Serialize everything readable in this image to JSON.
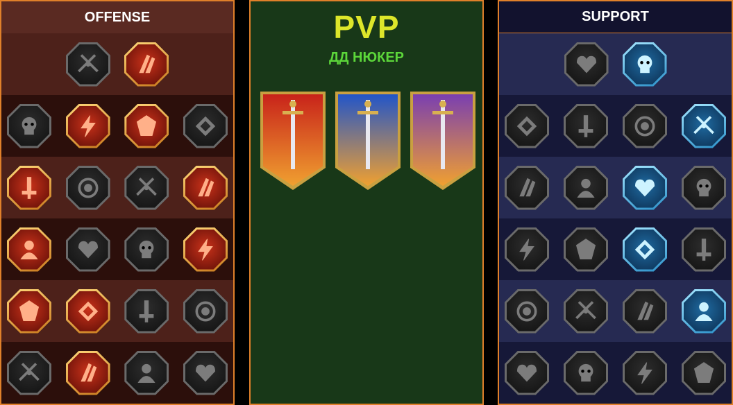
{
  "offense": {
    "title": "OFFENSE",
    "rows": [
      [
        {
          "icon": "crossed-swords-icon",
          "state": "gray"
        },
        {
          "icon": "triple-claw-icon",
          "state": "red"
        }
      ],
      [
        {
          "icon": "horned-demon-icon",
          "state": "gray"
        },
        {
          "icon": "slash-strikes-icon",
          "state": "red"
        },
        {
          "icon": "shield-break-icon",
          "state": "red"
        },
        {
          "icon": "broken-heart-icon",
          "state": "gray"
        }
      ],
      [
        {
          "icon": "arrow-hit-icon",
          "state": "red"
        },
        {
          "icon": "fangs-icon",
          "state": "gray"
        },
        {
          "icon": "skull-swipe-icon",
          "state": "gray"
        },
        {
          "icon": "sickle-hand-icon",
          "state": "red"
        }
      ],
      [
        {
          "icon": "dagger-drop-icon",
          "state": "red"
        },
        {
          "icon": "fist-hammer-icon",
          "state": "gray"
        },
        {
          "icon": "battle-axe-icon",
          "state": "gray"
        },
        {
          "icon": "lightning-chain-icon",
          "state": "red"
        }
      ],
      [
        {
          "icon": "explosion-icon",
          "state": "red"
        },
        {
          "icon": "twin-skulls-icon",
          "state": "red"
        },
        {
          "icon": "sword-shield-icon",
          "state": "gray"
        },
        {
          "icon": "warrior-body-icon",
          "state": "gray"
        }
      ],
      [
        {
          "icon": "sword-sparkle-icon",
          "state": "gray"
        },
        {
          "icon": "flaming-helmet-icon",
          "state": "red"
        },
        {
          "icon": "beast-icon",
          "state": "gray"
        },
        {
          "icon": "skull-totem-icon",
          "state": "gray"
        }
      ]
    ]
  },
  "pvp": {
    "title": "PVP",
    "subtitle": "ДД НЮКЕР",
    "banners": [
      {
        "icon": "red-knight-sword-banner-icon",
        "color": "#c8231a"
      },
      {
        "icon": "blue-triple-sword-banner-icon",
        "color": "#2255c8"
      },
      {
        "icon": "crossed-swords-duel-banner-icon",
        "color": "#7a3fb0"
      }
    ]
  },
  "support": {
    "title": "SUPPORT",
    "rows": [
      [
        {
          "icon": "heart-plus-icon",
          "state": "gray"
        },
        {
          "icon": "eye-swirl-icon",
          "state": "blue"
        }
      ],
      [
        {
          "icon": "praying-hands-icon",
          "state": "gray"
        },
        {
          "icon": "shield-rings-icon",
          "state": "gray"
        },
        {
          "icon": "flame-skull-icon",
          "state": "gray"
        },
        {
          "icon": "blade-strike-icon",
          "state": "blue"
        }
      ],
      [
        {
          "icon": "healer-figure-icon",
          "state": "gray"
        },
        {
          "icon": "lightning-bolt-icon",
          "state": "gray"
        },
        {
          "icon": "electric-ground-icon",
          "state": "blue"
        },
        {
          "icon": "shadow-figures-icon",
          "state": "gray"
        }
      ],
      [
        {
          "icon": "heart-chain-icon",
          "state": "gray"
        },
        {
          "icon": "comet-icon",
          "state": "gray"
        },
        {
          "icon": "open-book-icon",
          "state": "blue"
        },
        {
          "icon": "angry-eyes-icon",
          "state": "gray"
        }
      ],
      [
        {
          "icon": "compass-star-icon",
          "state": "gray"
        },
        {
          "icon": "speed-boot-icon",
          "state": "gray"
        },
        {
          "icon": "all-seeing-eye-icon",
          "state": "gray"
        },
        {
          "icon": "cross-stitch-icon",
          "state": "blue"
        }
      ],
      [
        {
          "icon": "potion-flask-icon",
          "state": "gray"
        },
        {
          "icon": "skull-wings-icon",
          "state": "gray"
        },
        {
          "icon": "clenched-fist-icon",
          "state": "gray"
        },
        {
          "icon": "eagle-head-icon",
          "state": "gray"
        }
      ]
    ]
  }
}
